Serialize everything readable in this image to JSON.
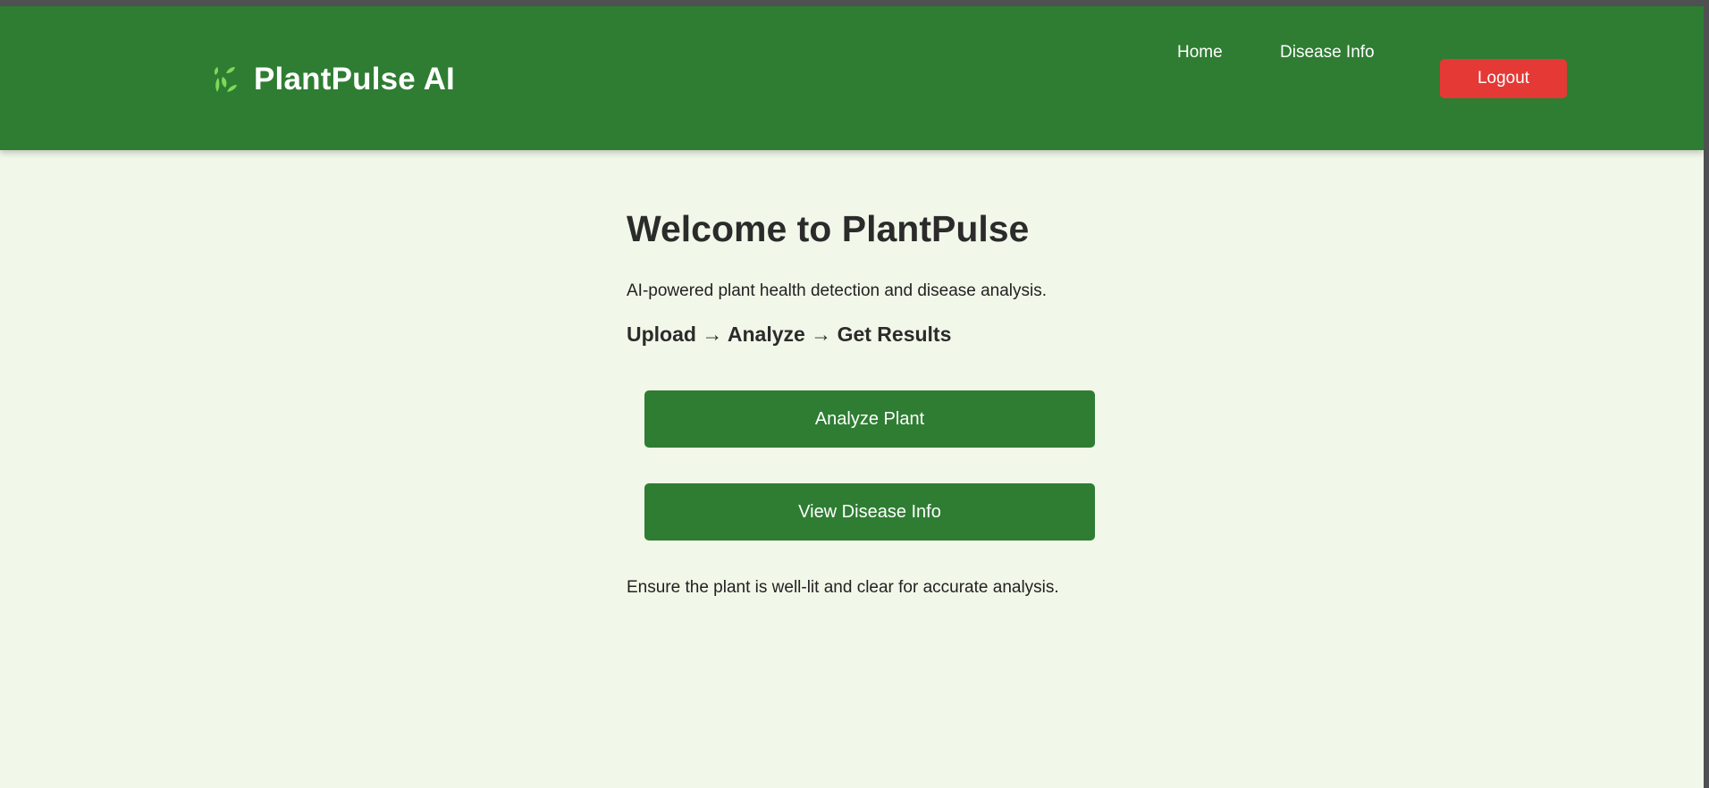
{
  "header": {
    "brand_icon": "seedling-icon",
    "brand_title": "PlantPulse AI",
    "nav": {
      "home": "Home",
      "disease_info": "Disease Info"
    },
    "logout_label": "Logout"
  },
  "main": {
    "title": "Welcome to PlantPulse",
    "subtitle": "AI-powered plant health detection and disease analysis.",
    "steps": "Upload → Analyze → Get Results",
    "analyze_button": "Analyze Plant",
    "disease_button": "View Disease Info",
    "note": "Ensure the plant is well-lit and clear for accurate analysis."
  },
  "colors": {
    "header_bg": "#2e7d32",
    "page_bg": "#f1f8e9",
    "primary_button": "#2e7d32",
    "logout_button": "#e53935",
    "icon_leaf": "#7ed957"
  }
}
